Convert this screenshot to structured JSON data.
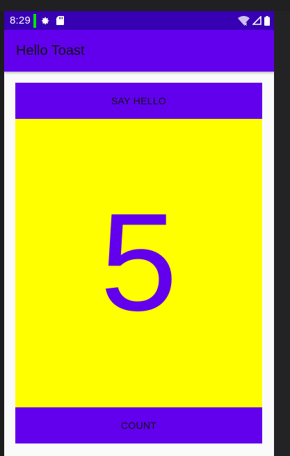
{
  "status_bar": {
    "time": "8:29",
    "icons": [
      "settings-icon",
      "sd-card-icon",
      "wifi-icon",
      "signal-icon",
      "battery-icon"
    ],
    "indicator_color": "#00e600"
  },
  "app_bar": {
    "title": "Hello Toast"
  },
  "main": {
    "say_hello_label": "SAY HELLO",
    "count_value": "5",
    "count_label": "COUNT"
  },
  "colors": {
    "status_bar": "#3700b3",
    "primary": "#6200ee",
    "count_background": "#ffff00",
    "count_text": "#6200ee"
  }
}
